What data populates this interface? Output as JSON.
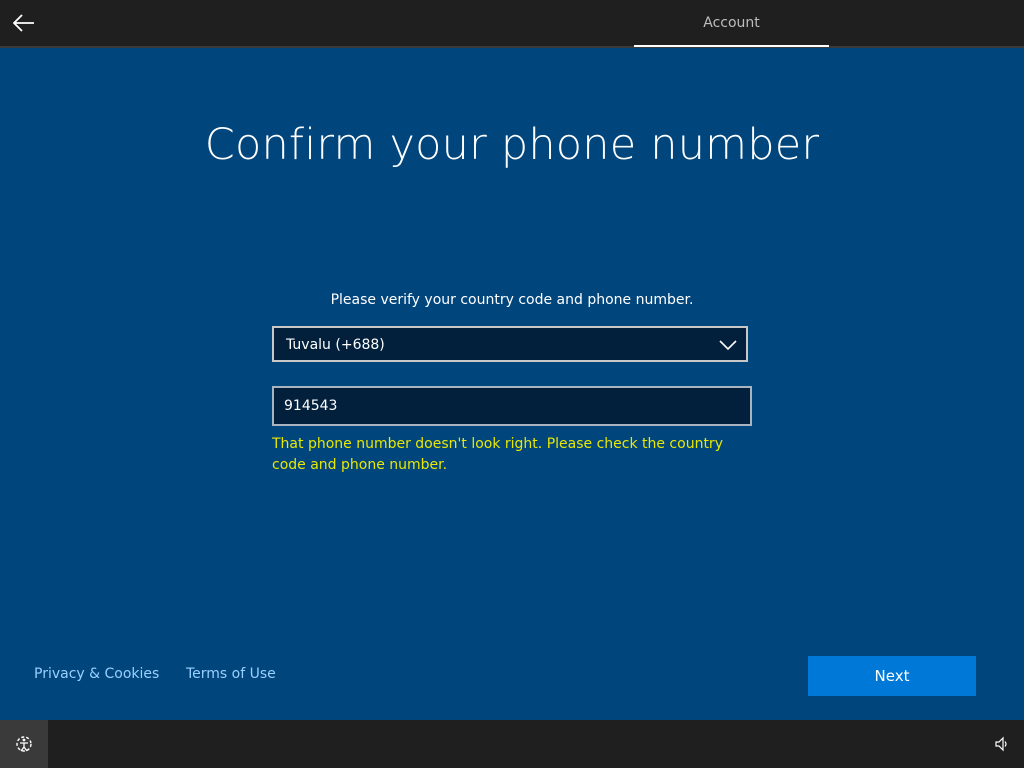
{
  "header": {
    "back_icon": "back-arrow-icon",
    "tab_label": "Account"
  },
  "main": {
    "title": "Confirm your phone number",
    "instructions": "Please verify your country code and phone number.",
    "country_select": {
      "selected": "Tuvalu (+688)",
      "icon": "chevron-down-icon"
    },
    "phone_input": {
      "value": "914543"
    },
    "error_message": "That phone number doesn't look right. Please check the country code and phone number."
  },
  "footer": {
    "privacy_label": "Privacy & Cookies",
    "terms_label": "Terms of Use",
    "next_label": "Next"
  },
  "taskbar": {
    "ease_icon": "ease-of-access-icon",
    "volume_icon": "volume-icon"
  },
  "colors": {
    "background": "#00457c",
    "error": "#e8e800",
    "link": "#9ad0ff",
    "primary_button": "#0078d7"
  }
}
